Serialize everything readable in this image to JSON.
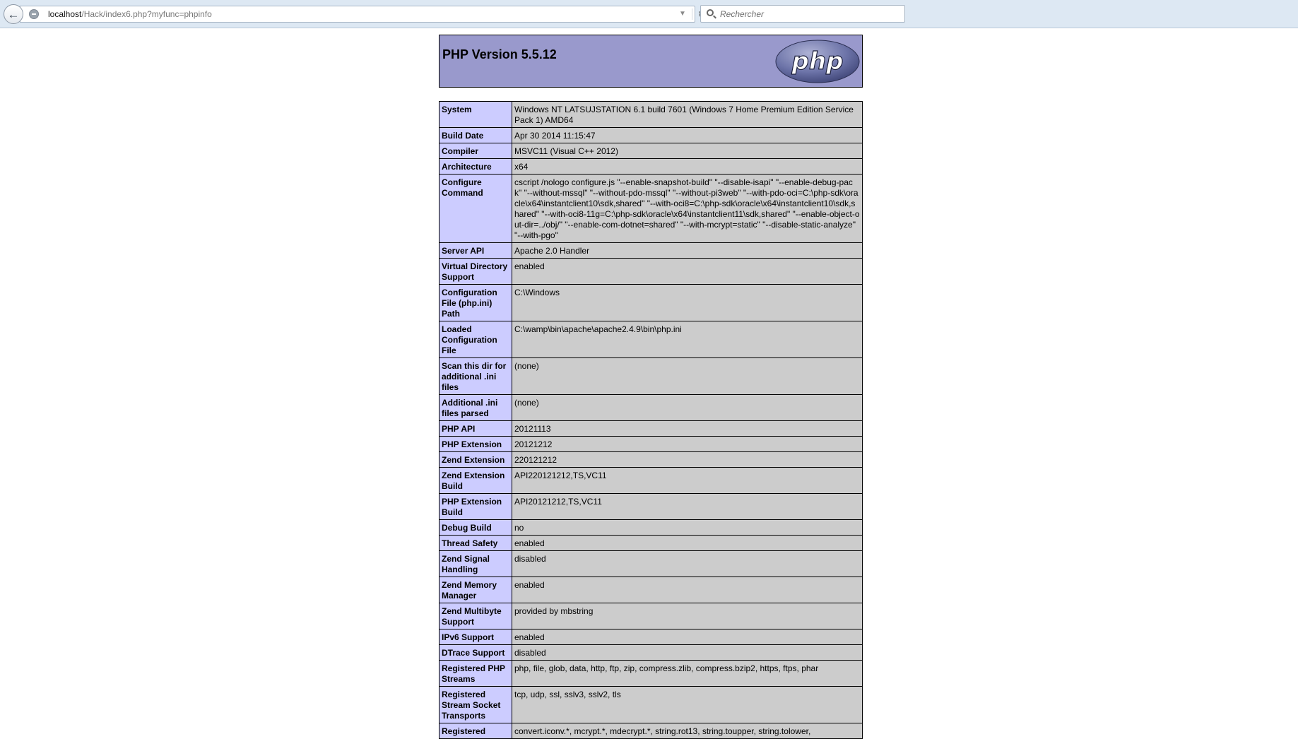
{
  "browser": {
    "url_host": "localhost",
    "url_path": "/Hack/index6.php?myfunc=phpinfo",
    "search_placeholder": "Rechercher"
  },
  "page": {
    "title": "PHP Version 5.5.12",
    "logo_text": "php"
  },
  "rows": [
    {
      "label": "System",
      "value": "Windows NT LATSUJSTATION 6.1 build 7601 (Windows 7 Home Premium Edition Service Pack 1) AMD64"
    },
    {
      "label": "Build Date",
      "value": "Apr 30 2014 11:15:47"
    },
    {
      "label": "Compiler",
      "value": "MSVC11 (Visual C++ 2012)"
    },
    {
      "label": "Architecture",
      "value": "x64"
    },
    {
      "label": "Configure Command",
      "value": "cscript /nologo configure.js \"--enable-snapshot-build\" \"--disable-isapi\" \"--enable-debug-pack\" \"--without-mssql\" \"--without-pdo-mssql\" \"--without-pi3web\" \"--with-pdo-oci=C:\\php-sdk\\oracle\\x64\\instantclient10\\sdk,shared\" \"--with-oci8=C:\\php-sdk\\oracle\\x64\\instantclient10\\sdk,shared\" \"--with-oci8-11g=C:\\php-sdk\\oracle\\x64\\instantclient11\\sdk,shared\" \"--enable-object-out-dir=../obj/\" \"--enable-com-dotnet=shared\" \"--with-mcrypt=static\" \"--disable-static-analyze\" \"--with-pgo\""
    },
    {
      "label": "Server API",
      "value": "Apache 2.0 Handler"
    },
    {
      "label": "Virtual Directory Support",
      "value": "enabled"
    },
    {
      "label": "Configuration File (php.ini) Path",
      "value": "C:\\Windows"
    },
    {
      "label": "Loaded Configuration File",
      "value": "C:\\wamp\\bin\\apache\\apache2.4.9\\bin\\php.ini"
    },
    {
      "label": "Scan this dir for additional .ini files",
      "value": "(none)"
    },
    {
      "label": "Additional .ini files parsed",
      "value": "(none)"
    },
    {
      "label": "PHP API",
      "value": "20121113"
    },
    {
      "label": "PHP Extension",
      "value": "20121212"
    },
    {
      "label": "Zend Extension",
      "value": "220121212"
    },
    {
      "label": "Zend Extension Build",
      "value": "API220121212,TS,VC11"
    },
    {
      "label": "PHP Extension Build",
      "value": "API20121212,TS,VC11"
    },
    {
      "label": "Debug Build",
      "value": "no"
    },
    {
      "label": "Thread Safety",
      "value": "enabled"
    },
    {
      "label": "Zend Signal Handling",
      "value": "disabled"
    },
    {
      "label": "Zend Memory Manager",
      "value": "enabled"
    },
    {
      "label": "Zend Multibyte Support",
      "value": "provided by mbstring"
    },
    {
      "label": "IPv6 Support",
      "value": "enabled"
    },
    {
      "label": "DTrace Support",
      "value": "disabled"
    },
    {
      "label": "Registered PHP Streams",
      "value": "php, file, glob, data, http, ftp, zip, compress.zlib, compress.bzip2, https, ftps, phar"
    },
    {
      "label": "Registered Stream Socket Transports",
      "value": "tcp, udp, ssl, sslv3, sslv2, tls"
    },
    {
      "label": "Registered",
      "value": "convert.iconv.*, mcrypt.*, mdecrypt.*, string.rot13, string.toupper, string.tolower,"
    }
  ],
  "colors": {
    "header_bg": "#9999cc",
    "label_bg": "#ccccff",
    "value_bg": "#cccccc",
    "chrome_bg": "#dde8f3"
  }
}
